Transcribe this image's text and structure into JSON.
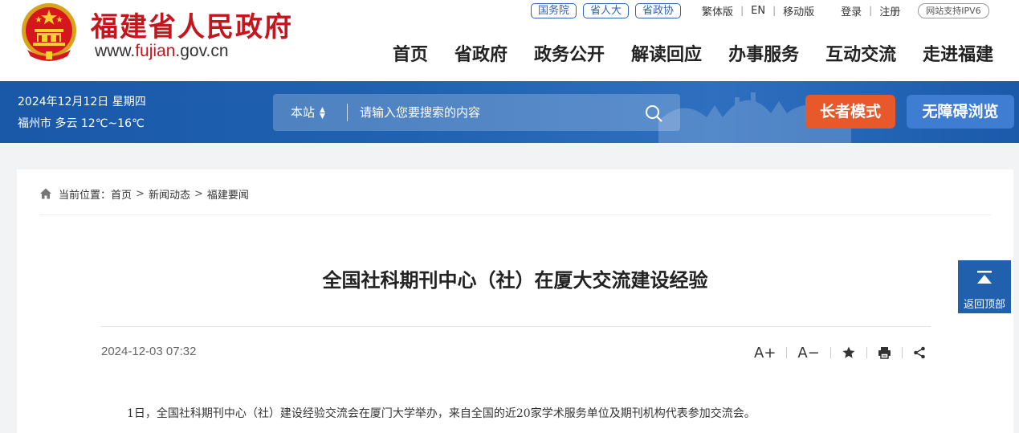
{
  "header": {
    "site_title": "福建省人民政府",
    "url_prefix": "www.",
    "url_domain": "fujian",
    "url_suffix": ".gov.cn",
    "portal_links": [
      {
        "label": "国务院"
      },
      {
        "label": "省人大"
      },
      {
        "label": "省政协"
      }
    ],
    "lang_traditional": "繁体版",
    "lang_en": "EN",
    "mobile": "移动版",
    "login": "登录",
    "register": "注册",
    "ipv6": "网站支持IPV6",
    "nav": [
      {
        "label": "首页"
      },
      {
        "label": "省政府"
      },
      {
        "label": "政务公开"
      },
      {
        "label": "解读回应"
      },
      {
        "label": "办事服务"
      },
      {
        "label": "互动交流"
      },
      {
        "label": "走进福建"
      }
    ]
  },
  "band": {
    "date": "2024年12月12日 星期四",
    "weather": "福州市 多云 12℃~16℃",
    "search_scope": "本站",
    "search_placeholder": "请输入您要搜索的内容",
    "elder_mode": "长者模式",
    "accessible": "无障碍浏览"
  },
  "breadcrumb": {
    "prefix": "当前位置：",
    "items": [
      {
        "label": "首页"
      },
      {
        "label": "新闻动态"
      },
      {
        "label": "福建要闻"
      }
    ],
    "separator": ">"
  },
  "article": {
    "title": "全国社科期刊中心（社）在厦大交流建设经验",
    "date": "2024-12-03 07:32",
    "font_larger": "A+",
    "font_smaller": "A−",
    "body_first_line": "1日，全国社科期刊中心（社）建设经验交流会在厦门大学举办，来自全国的近20家学术服务单位及期刊机构代表参加交流会。"
  },
  "back_to_top": {
    "label": "返回顶部"
  },
  "colors": {
    "brand_red": "#c4161c",
    "band_blue": "#2062b2",
    "elder_orange": "#e7582b",
    "access_blue": "#3f7dd3"
  }
}
